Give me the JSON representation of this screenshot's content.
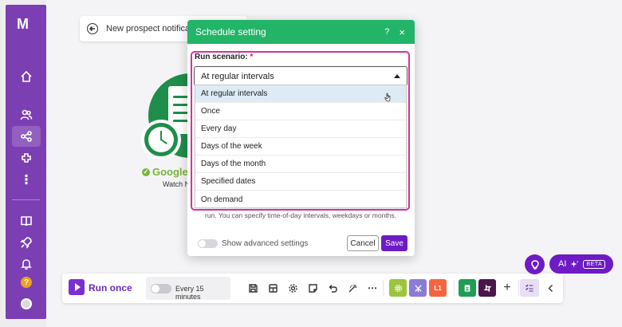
{
  "sidebar": {
    "logo": "M",
    "items": [
      "home-icon",
      "team-icon",
      "scenarios-icon",
      "apps-icon",
      "more-icon",
      "templates-icon",
      "launch-icon",
      "notifications-icon"
    ],
    "help_label": "?"
  },
  "header": {
    "title": "New prospect notificatio"
  },
  "module": {
    "title": "Google",
    "subtitle": "Watch N"
  },
  "modal": {
    "title": "Schedule setting",
    "help_label": "?",
    "close_label": "×",
    "field_label": "Run scenario:",
    "required_mark": " *",
    "selected_value": "At regular intervals",
    "help_text": "run. You can specify time-of-day intervals, weekdays or months.",
    "advanced_label": "Show advanced settings",
    "cancel_label": "Cancel",
    "save_label": "Save"
  },
  "dropdown": {
    "options": [
      "At regular intervals",
      "Once",
      "Every day",
      "Days of the week",
      "Days of the month",
      "Specified dates",
      "On demand"
    ],
    "highlighted_index": 0
  },
  "toolbar": {
    "run_label": "Run once",
    "schedule_label": "Every 15 minutes",
    "tile_l1_label": "L1",
    "more_label": "⋯",
    "add_label": "+"
  },
  "ai": {
    "label": "AI",
    "badge": "BETA"
  },
  "colors": {
    "sidebar": "#7b3fb3",
    "modal_header": "#22b467",
    "primary": "#6d1bc4",
    "highlight_frame": "#d4339d",
    "module": "#1e8e4a"
  }
}
